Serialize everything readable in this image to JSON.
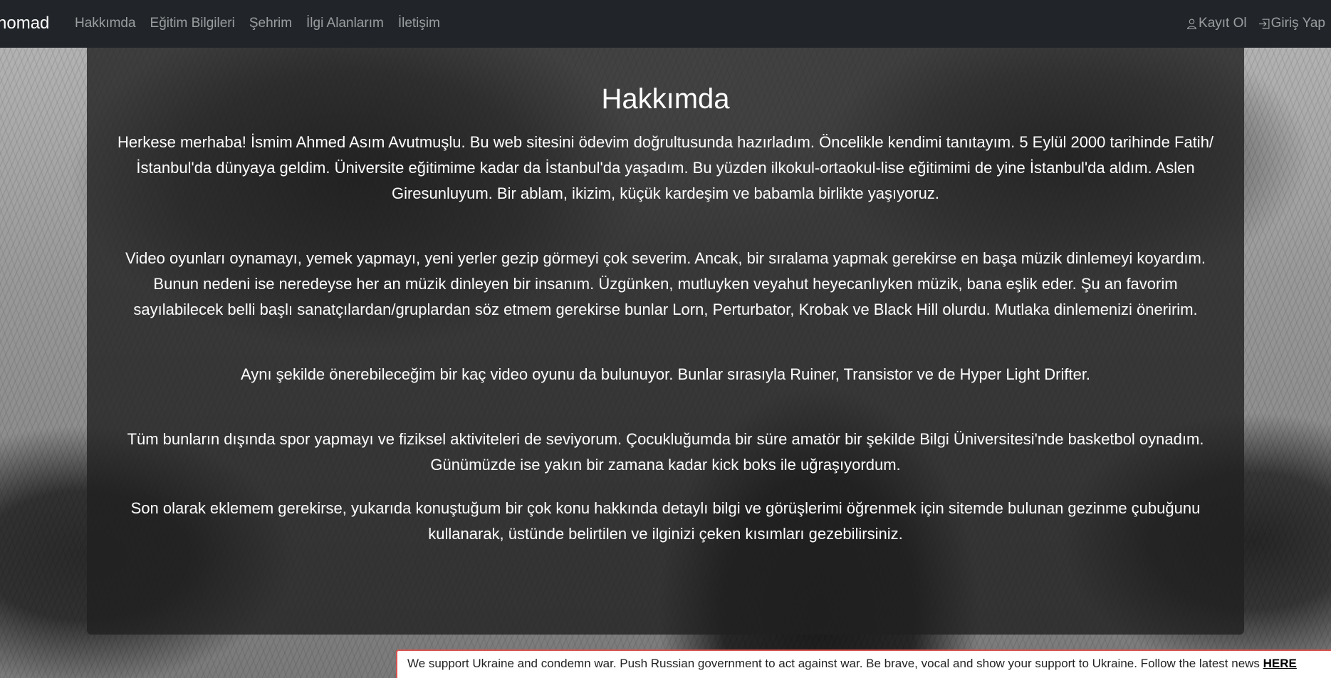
{
  "navbar": {
    "brand": "nomad",
    "links": [
      {
        "label": "Hakkımda"
      },
      {
        "label": "Eğitim Bilgileri"
      },
      {
        "label": "Şehrim"
      },
      {
        "label": "İlgi Alanlarım"
      },
      {
        "label": "İletişim"
      }
    ],
    "register_label": "Kayıt Ol",
    "login_label": "Giriş Yap"
  },
  "main": {
    "title": "Hakkımda",
    "paragraphs": [
      "Herkese merhaba! İsmim Ahmed Asım Avutmuşlu. Bu web sitesini ödevim doğrultusunda hazırladım. Öncelikle kendimi tanıtayım. 5 Eylül 2000 tarihinde Fatih/İstanbul'da dünyaya geldim. Üniversite eğitimime kadar da İstanbul'da yaşadım. Bu yüzden ilkokul-ortaokul-lise eğitimimi de yine İstanbul'da aldım. Aslen Giresunluyum. Bir ablam, ikizim, küçük kardeşim ve babamla birlikte yaşıyoruz.",
      "Video oyunları oynamayı, yemek yapmayı, yeni yerler gezip görmeyi çok severim. Ancak, bir sıralama yapmak gerekirse en başa müzik dinlemeyi koyardım. Bunun nedeni ise neredeyse her an müzik dinleyen bir insanım. Üzgünken, mutluyken veyahut heyecanlıyken müzik, bana eşlik eder. Şu an favorim sayılabilecek belli başlı sanatçılardan/gruplardan söz etmem gerekirse bunlar Lorn, Perturbator, Krobak ve Black Hill olurdu. Mutlaka dinlemenizi öneririm.",
      "Aynı şekilde önerebileceğim bir kaç video oyunu da bulunuyor. Bunlar sırasıyla Ruiner, Transistor ve de Hyper Light Drifter.",
      "Tüm bunların dışında spor yapmayı ve fiziksel aktiviteleri de seviyorum. Çocukluğumda bir süre amatör bir şekilde Bilgi Üniversitesi'nde basketbol oynadım. Günümüzde ise yakın bir zamana kadar kick boks ile uğraşıyordum.",
      "Son olarak eklemem gerekirse, yukarıda konuştuğum bir çok konu hakkında detaylı bilgi ve görüşlerimi öğrenmek için sitemde bulunan gezinme çubuğunu kullanarak, üstünde belirtilen ve ilginizi çeken kısımları gezebilirsiniz."
    ]
  },
  "banner": {
    "text": "We support Ukraine and condemn war. Push Russian government to act against war. Be brave, vocal and show your support to Ukraine. Follow the latest news ",
    "link_label": "HERE"
  },
  "icons": {
    "register": "person-icon",
    "login": "box-arrow-in-right-icon"
  },
  "colors": {
    "navbar_bg": "#212529",
    "nav_link": "rgba(255,255,255,0.55)",
    "card_bg": "rgba(33,33,33,0.8)",
    "banner_border": "#d9534f"
  }
}
